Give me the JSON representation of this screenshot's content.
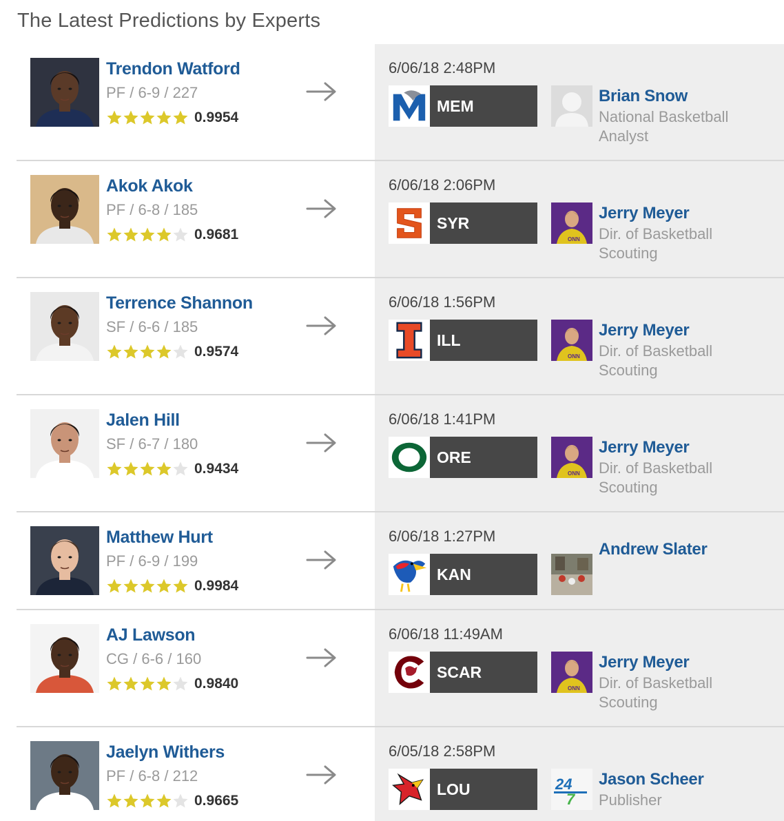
{
  "page": {
    "title": "The Latest Predictions by Experts"
  },
  "colors": {
    "link": "#1f5b96",
    "star_on": "#dcc82a",
    "star_off": "#e4e4e4",
    "team_bar": "#474747",
    "panel": "#eeeeee"
  },
  "predictions": [
    {
      "player": {
        "name": "Trendon Watford",
        "meta": "PF / 6-9 / 227",
        "stars": 5,
        "rating": "0.9954"
      },
      "date": "6/06/18 2:48PM",
      "team": {
        "abbr": "MEM",
        "logo_icon": "memphis-tiger-logo-icon"
      },
      "expert": {
        "name": "Brian Snow",
        "title": "National Basketball Analyst",
        "avatar_icon": "placeholder-avatar-icon"
      }
    },
    {
      "player": {
        "name": "Akok Akok",
        "meta": "PF / 6-8 / 185",
        "stars": 4,
        "rating": "0.9681"
      },
      "date": "6/06/18 2:06PM",
      "team": {
        "abbr": "SYR",
        "logo_icon": "syracuse-s-logo-icon"
      },
      "expert": {
        "name": "Jerry Meyer",
        "title": "Dir. of Basketball Scouting",
        "avatar_icon": "expert-photo-icon"
      }
    },
    {
      "player": {
        "name": "Terrence Shannon",
        "meta": "SF / 6-6 / 185",
        "stars": 4,
        "rating": "0.9574"
      },
      "date": "6/06/18 1:56PM",
      "team": {
        "abbr": "ILL",
        "logo_icon": "illinois-i-logo-icon"
      },
      "expert": {
        "name": "Jerry Meyer",
        "title": "Dir. of Basketball Scouting",
        "avatar_icon": "expert-photo-icon"
      }
    },
    {
      "player": {
        "name": "Jalen Hill",
        "meta": "SF / 6-7 / 180",
        "stars": 4,
        "rating": "0.9434"
      },
      "date": "6/06/18 1:41PM",
      "team": {
        "abbr": "ORE",
        "logo_icon": "oregon-o-logo-icon"
      },
      "expert": {
        "name": "Jerry Meyer",
        "title": "Dir. of Basketball Scouting",
        "avatar_icon": "expert-photo-icon"
      }
    },
    {
      "player": {
        "name": "Matthew Hurt",
        "meta": "PF / 6-9 / 199",
        "stars": 5,
        "rating": "0.9984"
      },
      "date": "6/06/18 1:27PM",
      "team": {
        "abbr": "KAN",
        "logo_icon": "kansas-jayhawk-logo-icon"
      },
      "expert": {
        "name": "Andrew Slater",
        "title": "",
        "avatar_icon": "expert-photo-icon"
      }
    },
    {
      "player": {
        "name": "AJ Lawson",
        "meta": "CG / 6-6 / 160",
        "stars": 4,
        "rating": "0.9840"
      },
      "date": "6/06/18 11:49AM",
      "team": {
        "abbr": "SCAR",
        "logo_icon": "south-carolina-gamecock-logo-icon"
      },
      "expert": {
        "name": "Jerry Meyer",
        "title": "Dir. of Basketball Scouting",
        "avatar_icon": "expert-photo-icon"
      }
    },
    {
      "player": {
        "name": "Jaelyn Withers",
        "meta": "PF / 6-8 / 212",
        "stars": 4,
        "rating": "0.9665"
      },
      "date": "6/05/18 2:58PM",
      "team": {
        "abbr": "LOU",
        "logo_icon": "louisville-cardinal-logo-icon"
      },
      "expert": {
        "name": "Jason Scheer",
        "title": "Publisher",
        "avatar_icon": "247-logo-icon"
      }
    }
  ]
}
